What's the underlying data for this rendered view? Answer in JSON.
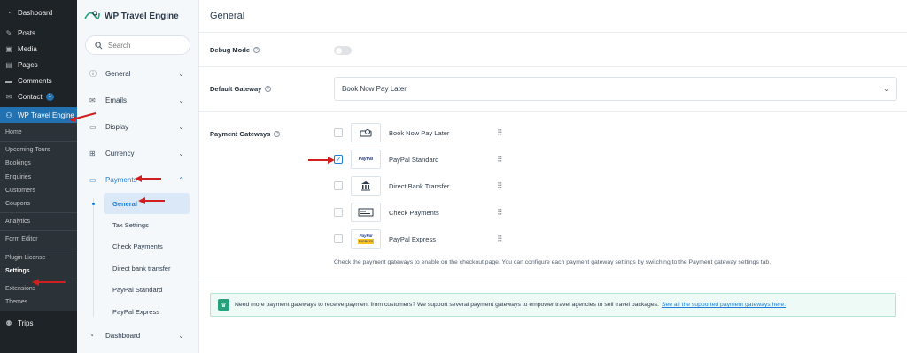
{
  "wp_menu": {
    "top": [
      {
        "label": "Dashboard",
        "icon": "dashboard-icon"
      },
      {
        "label": "Posts",
        "icon": "pin-icon"
      },
      {
        "label": "Media",
        "icon": "media-icon"
      },
      {
        "label": "Pages",
        "icon": "pages-icon"
      },
      {
        "label": "Comments",
        "icon": "comment-icon"
      },
      {
        "label": "Contact",
        "icon": "mail-icon",
        "badge": "1"
      },
      {
        "label": "WP Travel Engine",
        "icon": "travel-icon"
      }
    ],
    "sub": [
      "Home",
      "Upcoming Tours",
      "Bookings",
      "Enquiries",
      "Customers",
      "Coupons",
      "Analytics",
      "Form Editor",
      "Plugin License",
      "Settings",
      "Extensions",
      "Themes"
    ],
    "bottom": {
      "label": "Trips",
      "icon": "trips-icon"
    }
  },
  "plugin": {
    "logo_text": "WP Travel Engine",
    "search_placeholder": "Search",
    "nav": [
      {
        "label": "General",
        "icon": "info-icon"
      },
      {
        "label": "Emails",
        "icon": "mail-icon"
      },
      {
        "label": "Display",
        "icon": "display-icon"
      },
      {
        "label": "Currency",
        "icon": "grid-icon"
      },
      {
        "label": "Payments",
        "icon": "card-icon"
      }
    ],
    "payments_sub": [
      "General",
      "Tax Settings",
      "Check Payments",
      "Direct bank transfer",
      "PayPal Standard",
      "PayPal Express"
    ],
    "nav_after": {
      "label": "Dashboard",
      "icon": "dashboard-icon"
    }
  },
  "main": {
    "title": "General",
    "debug_mode_label": "Debug Mode",
    "default_gateway_label": "Default Gateway",
    "default_gateway_value": "Book Now Pay Later",
    "payment_gateways_label": "Payment Gateways",
    "gateways": [
      {
        "name": "Book Now Pay Later",
        "checked": false
      },
      {
        "name": "PayPal Standard",
        "checked": true
      },
      {
        "name": "Direct Bank Transfer",
        "checked": false
      },
      {
        "name": "Check Payments",
        "checked": false
      },
      {
        "name": "PayPal Express",
        "checked": false
      }
    ],
    "paypal_logo_text": "PayPal",
    "express_logo_text": "EXPRESS",
    "help_text": "Check the payment gateways to enable on the checkout page. You can configure each payment gateway settings by switching to the Payment gateway settings tab.",
    "notice_text": "Need more payment gateways to receive payment from customers? We support several payment gateways to empower travel agencies to sell travel packages.",
    "notice_link": "See all the supported payment gateways here."
  },
  "colors": {
    "accent": "#1c7ed6",
    "wp_active": "#2271b1",
    "arrow": "#d11f1f"
  }
}
